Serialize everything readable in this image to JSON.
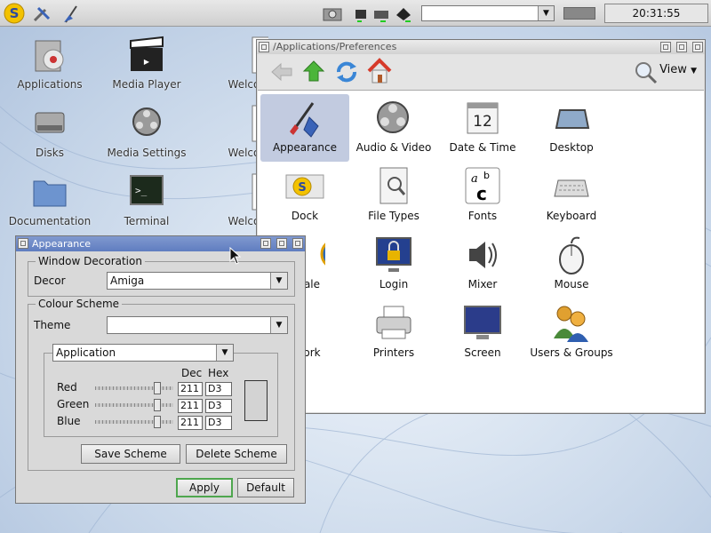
{
  "taskbar": {
    "clock": "20:31:55",
    "search_value": ""
  },
  "desktop_icons": [
    {
      "label": "Applications",
      "icon": "applications-icon"
    },
    {
      "label": "Media Player",
      "icon": "clapperboard-icon"
    },
    {
      "label": "Welcome",
      "icon": "welcome-doc-icon"
    },
    {
      "label": "Disks",
      "icon": "disk-icon"
    },
    {
      "label": "Media Settings",
      "icon": "film-reel-icon"
    },
    {
      "label": "Welcome",
      "icon": "welcome-doc-icon"
    },
    {
      "label": "Documentation",
      "icon": "folder-icon"
    },
    {
      "label": "Terminal",
      "icon": "terminal-icon"
    },
    {
      "label": "Welcome",
      "icon": "welcome-doc-icon"
    }
  ],
  "prefs_window": {
    "title": "/Applications/Preferences",
    "view_label": "View",
    "items": [
      {
        "label": "Appearance",
        "icon": "paintbrush-icon",
        "selected": true
      },
      {
        "label": "Audio & Video",
        "icon": "film-reel-icon"
      },
      {
        "label": "Date & Time",
        "icon": "calendar-icon",
        "day": "12"
      },
      {
        "label": "Desktop",
        "icon": "desktop-icon"
      },
      {
        "label": "Dock",
        "icon": "dock-icon"
      },
      {
        "label": "File Types",
        "icon": "file-types-icon"
      },
      {
        "label": "Fonts",
        "icon": "fonts-icon"
      },
      {
        "label": "Keyboard",
        "icon": "keyboard-icon"
      },
      {
        "label": "Locale",
        "icon": "globe-icon",
        "visible_label": "ale"
      },
      {
        "label": "Login",
        "icon": "login-lock-icon"
      },
      {
        "label": "Mixer",
        "icon": "speaker-icon"
      },
      {
        "label": "Mouse",
        "icon": "mouse-icon"
      },
      {
        "label": "Network",
        "icon": "network-icon",
        "visible_label": "ork"
      },
      {
        "label": "Printers",
        "icon": "printer-icon"
      },
      {
        "label": "Screen",
        "icon": "monitor-icon"
      },
      {
        "label": "Users & Groups",
        "icon": "users-icon"
      }
    ]
  },
  "appearance_window": {
    "title": "Appearance",
    "window_decoration": {
      "legend": "Window Decoration",
      "decor_label": "Decor",
      "decor_value": "Amiga"
    },
    "colour_scheme": {
      "legend": "Colour Scheme",
      "theme_label": "Theme",
      "theme_value": "",
      "element_value": "Application",
      "dec_header": "Dec",
      "hex_header": "Hex",
      "channels": [
        {
          "label": "Red",
          "dec": "211",
          "hex": "D3",
          "level": 0.83
        },
        {
          "label": "Green",
          "dec": "211",
          "hex": "D3",
          "level": 0.83
        },
        {
          "label": "Blue",
          "dec": "211",
          "hex": "D3",
          "level": 0.83
        }
      ],
      "swatch_color": "#d3d3d3",
      "save_scheme": "Save Scheme",
      "delete_scheme": "Delete Scheme"
    },
    "apply": "Apply",
    "default": "Default"
  }
}
